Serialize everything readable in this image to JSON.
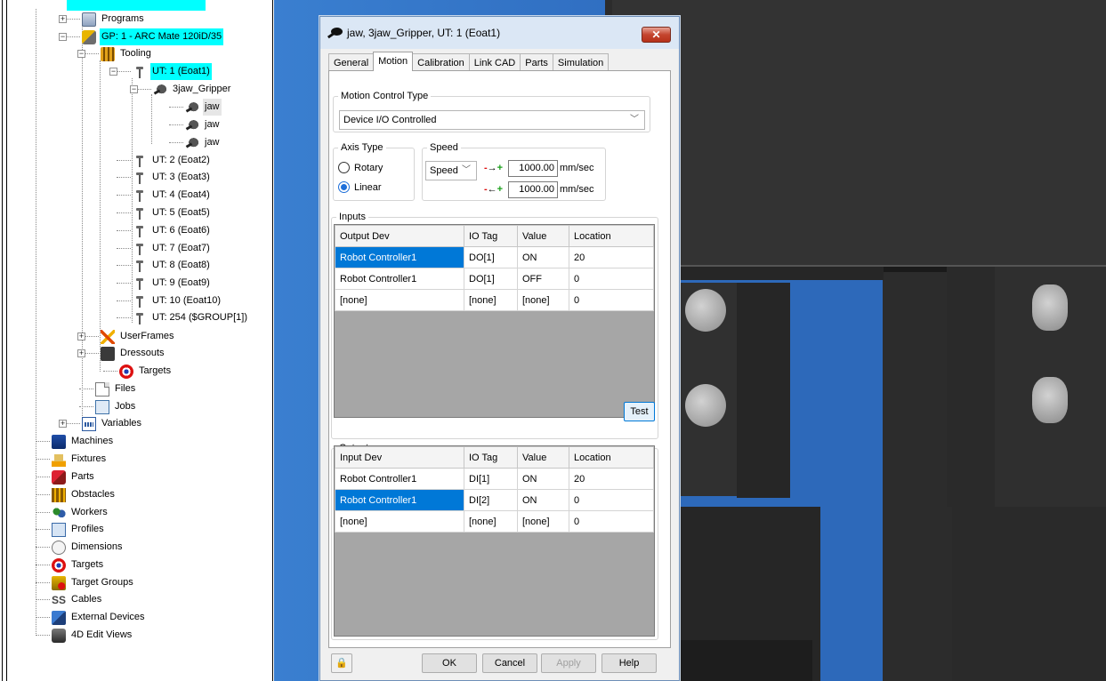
{
  "tree": {
    "items": [
      {
        "label": "Programs",
        "icon": "programs-icon"
      },
      {
        "label": "GP: 1 - ARC Mate 120iD/35",
        "icon": "robot-icon"
      },
      {
        "label": "Tooling",
        "icon": "tooling-icon"
      },
      {
        "label": "UT: 1  (Eoat1)",
        "icon": "tool-icon"
      },
      {
        "label": "3jaw_Gripper",
        "icon": "gripper-icon"
      },
      {
        "label": "jaw",
        "icon": "gripper-icon"
      },
      {
        "label": "jaw",
        "icon": "gripper-icon"
      },
      {
        "label": "jaw",
        "icon": "gripper-icon"
      },
      {
        "label": "UT: 2  (Eoat2)",
        "icon": "tool-icon"
      },
      {
        "label": "UT: 3  (Eoat3)",
        "icon": "tool-icon"
      },
      {
        "label": "UT: 4  (Eoat4)",
        "icon": "tool-icon"
      },
      {
        "label": "UT: 5  (Eoat5)",
        "icon": "tool-icon"
      },
      {
        "label": "UT: 6  (Eoat6)",
        "icon": "tool-icon"
      },
      {
        "label": "UT: 7  (Eoat7)",
        "icon": "tool-icon"
      },
      {
        "label": "UT: 8  (Eoat8)",
        "icon": "tool-icon"
      },
      {
        "label": "UT: 9  (Eoat9)",
        "icon": "tool-icon"
      },
      {
        "label": "UT: 10  (Eoat10)",
        "icon": "tool-icon"
      },
      {
        "label": "UT: 254  ($GROUP[1])",
        "icon": "tool-icon"
      },
      {
        "label": "UserFrames",
        "icon": "userframes-icon"
      },
      {
        "label": "Dressouts",
        "icon": "dressouts-icon"
      },
      {
        "label": "Targets",
        "icon": "target-icon"
      },
      {
        "label": "Files",
        "icon": "file-icon"
      },
      {
        "label": "Jobs",
        "icon": "jobs-icon"
      },
      {
        "label": "Variables",
        "icon": "variables-icon"
      },
      {
        "label": "Machines",
        "icon": "machine-icon"
      },
      {
        "label": "Fixtures",
        "icon": "fixture-icon"
      },
      {
        "label": "Parts",
        "icon": "parts-icon"
      },
      {
        "label": "Obstacles",
        "icon": "obstacle-icon"
      },
      {
        "label": "Workers",
        "icon": "workers-icon"
      },
      {
        "label": "Profiles",
        "icon": "profiles-icon"
      },
      {
        "label": "Dimensions",
        "icon": "dimensions-icon"
      },
      {
        "label": "Targets",
        "icon": "target-icon"
      },
      {
        "label": "Target Groups",
        "icon": "target-groups-icon"
      },
      {
        "label": "Cables",
        "icon": "cables-icon"
      },
      {
        "label": "External Devices",
        "icon": "external-devices-icon"
      },
      {
        "label": "4D Edit Views",
        "icon": "4d-edit-views-icon"
      }
    ],
    "cables_glyph": "SS"
  },
  "dialog": {
    "title": "jaw, 3jaw_Gripper, UT: 1  (Eoat1)",
    "close_glyph": "✕",
    "tabs": [
      "General",
      "Motion",
      "Calibration",
      "Link CAD",
      "Parts",
      "Simulation"
    ],
    "active_tab": "Motion",
    "motion_control": {
      "legend": "Motion Control Type",
      "value": "Device I/O Controlled"
    },
    "axis_type": {
      "legend": "Axis Type",
      "options": [
        "Rotary",
        "Linear"
      ],
      "selected": "Linear"
    },
    "speed": {
      "legend": "Speed",
      "mode": "Speed",
      "forward_arrow": "-→+",
      "reverse_arrow": "-←+",
      "forward_value": "1000.00",
      "reverse_value": "1000.00",
      "unit": "mm/sec"
    },
    "inputs": {
      "legend": "Inputs",
      "columns": [
        "Output Dev",
        "IO Tag",
        "Value",
        "Location"
      ],
      "rows": [
        [
          "Robot Controller1",
          "DO[1]",
          "ON",
          "20"
        ],
        [
          "Robot Controller1",
          "DO[1]",
          "OFF",
          "0"
        ],
        [
          "[none]",
          "[none]",
          "[none]",
          "0"
        ]
      ]
    },
    "test_label": "Test",
    "outputs": {
      "legend": "Outputs",
      "columns": [
        "Input Dev",
        "IO Tag",
        "Value",
        "Location"
      ],
      "rows": [
        [
          "Robot Controller1",
          "DI[1]",
          "ON",
          "20"
        ],
        [
          "Robot Controller1",
          "DI[2]",
          "ON",
          "0"
        ],
        [
          "[none]",
          "[none]",
          "[none]",
          "0"
        ]
      ]
    },
    "buttons": {
      "ok": "OK",
      "cancel": "Cancel",
      "apply": "Apply",
      "help": "Help"
    },
    "lock_glyph": "🔒"
  },
  "colors": {
    "highlight": "#00ffff",
    "selection": "#0078d7",
    "viewport_blue": "#2f6dc0"
  }
}
